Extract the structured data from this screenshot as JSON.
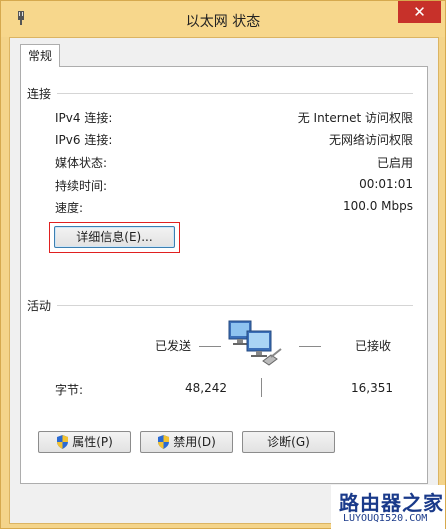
{
  "window": {
    "title": "以太网 状态",
    "close_glyph": "✕"
  },
  "tabs": [
    {
      "label": "常规"
    }
  ],
  "connection": {
    "group_label": "连接",
    "rows": [
      {
        "label": "IPv4 连接:",
        "value": "无 Internet 访问权限"
      },
      {
        "label": "IPv6 连接:",
        "value": "无网络访问权限"
      },
      {
        "label": "媒体状态:",
        "value": "已启用"
      },
      {
        "label": "持续时间:",
        "value": "00:01:01"
      },
      {
        "label": "速度:",
        "value": "100.0 Mbps"
      }
    ],
    "details_button": "详细信息(E)..."
  },
  "activity": {
    "group_label": "活动",
    "sent_label": "已发送",
    "received_label": "已接收",
    "bytes_label": "字节:",
    "bytes_sent": "48,242",
    "bytes_received": "16,351",
    "icon": "network-computers-icon"
  },
  "buttons": {
    "properties": "属性(P)",
    "disable": "禁用(D)",
    "diagnose": "诊断(G)"
  },
  "watermark": {
    "top": "路由器之家",
    "bottom": "LUYOUQI520.COM"
  },
  "colors": {
    "frame": "#f4d48a",
    "close": "#c7312a",
    "highlight_frame": "#e02020"
  }
}
